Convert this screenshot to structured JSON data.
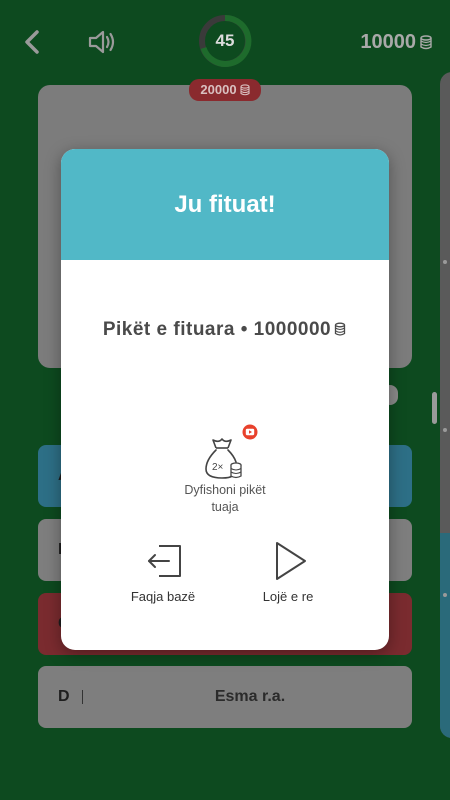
{
  "header": {
    "timer_value": "45",
    "prize_badge": "20000",
    "total_coins": "10000"
  },
  "answers": [
    {
      "letter": "A",
      "text": "",
      "state": "blue"
    },
    {
      "letter": "B",
      "text": "",
      "state": "grey"
    },
    {
      "letter": "C",
      "text": "",
      "state": "red"
    },
    {
      "letter": "D",
      "text": "Esma r.a.",
      "state": "grey"
    }
  ],
  "modal": {
    "title": "Ju fituat!",
    "score_label": "Pikët e fituara • 1000000",
    "double_label": "Dyfishoni pikët tuaja",
    "home_label": "Faqja bazë",
    "replay_label": "Lojë e re"
  },
  "colors": {
    "background": "#0d4a1f",
    "modal_header": "#51b8c7",
    "prize_badge": "#8a2a2e",
    "video_badge": "#e8412c"
  },
  "icons": {
    "back": "chevron-left-icon",
    "sound": "speaker-icon",
    "coin": "coin-stack-icon",
    "double": "money-bag-icon",
    "video": "video-play-icon",
    "home": "exit-door-icon",
    "replay": "play-icon"
  }
}
